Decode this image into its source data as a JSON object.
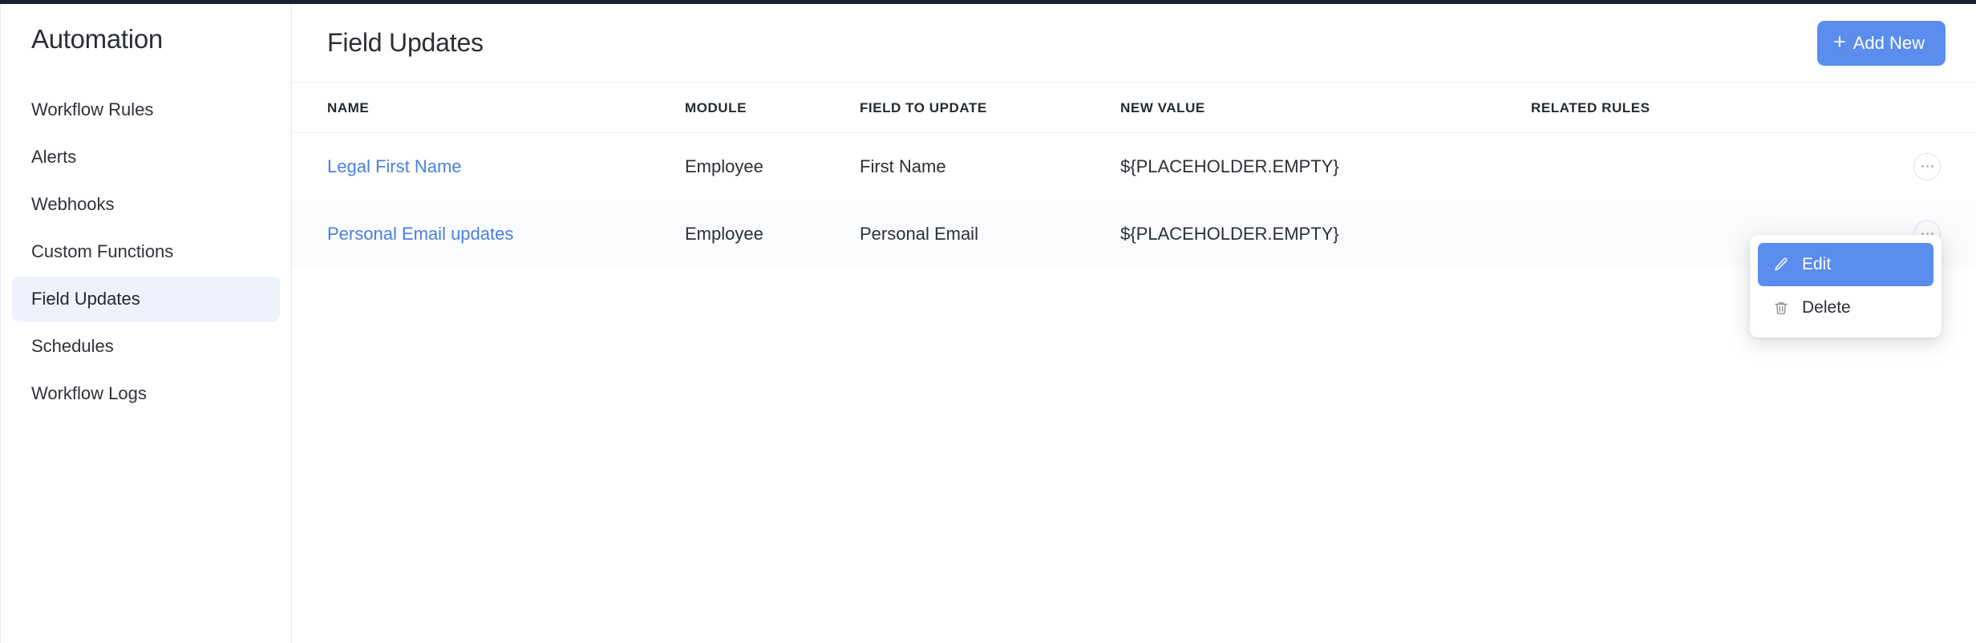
{
  "theme": {
    "accent_blue": "#5a8dee",
    "link_blue": "#4a7fe0",
    "sidebar_active_bg": "#eef2fd",
    "row_alt_bg": "#fafbfc",
    "top_bar": "#1d2030"
  },
  "sidebar": {
    "title": "Automation",
    "items": [
      {
        "label": "Workflow Rules",
        "active": false
      },
      {
        "label": "Alerts",
        "active": false
      },
      {
        "label": "Webhooks",
        "active": false
      },
      {
        "label": "Custom Functions",
        "active": false
      },
      {
        "label": "Field Updates",
        "active": true
      },
      {
        "label": "Schedules",
        "active": false
      },
      {
        "label": "Workflow Logs",
        "active": false
      }
    ]
  },
  "header": {
    "title": "Field Updates",
    "add_new_label": "Add New",
    "add_new_icon": "plus-icon"
  },
  "table": {
    "columns": [
      "NAME",
      "MODULE",
      "FIELD TO UPDATE",
      "NEW VALUE",
      "RELATED RULES"
    ],
    "rows": [
      {
        "name": "Legal First Name",
        "module": "Employee",
        "field_to_update": "First Name",
        "new_value": "${PLACEHOLDER.EMPTY}",
        "related_rules": "",
        "actions_icon": "ellipsis-icon"
      },
      {
        "name": "Personal Email updates",
        "module": "Employee",
        "field_to_update": "Personal Email",
        "new_value": "${PLACEHOLDER.EMPTY}",
        "related_rules": "",
        "actions_icon": "ellipsis-icon"
      }
    ]
  },
  "context_menu": {
    "visible": true,
    "items": [
      {
        "label": "Edit",
        "icon": "pencil-icon",
        "selected": true
      },
      {
        "label": "Delete",
        "icon": "trash-icon",
        "selected": false
      }
    ]
  }
}
